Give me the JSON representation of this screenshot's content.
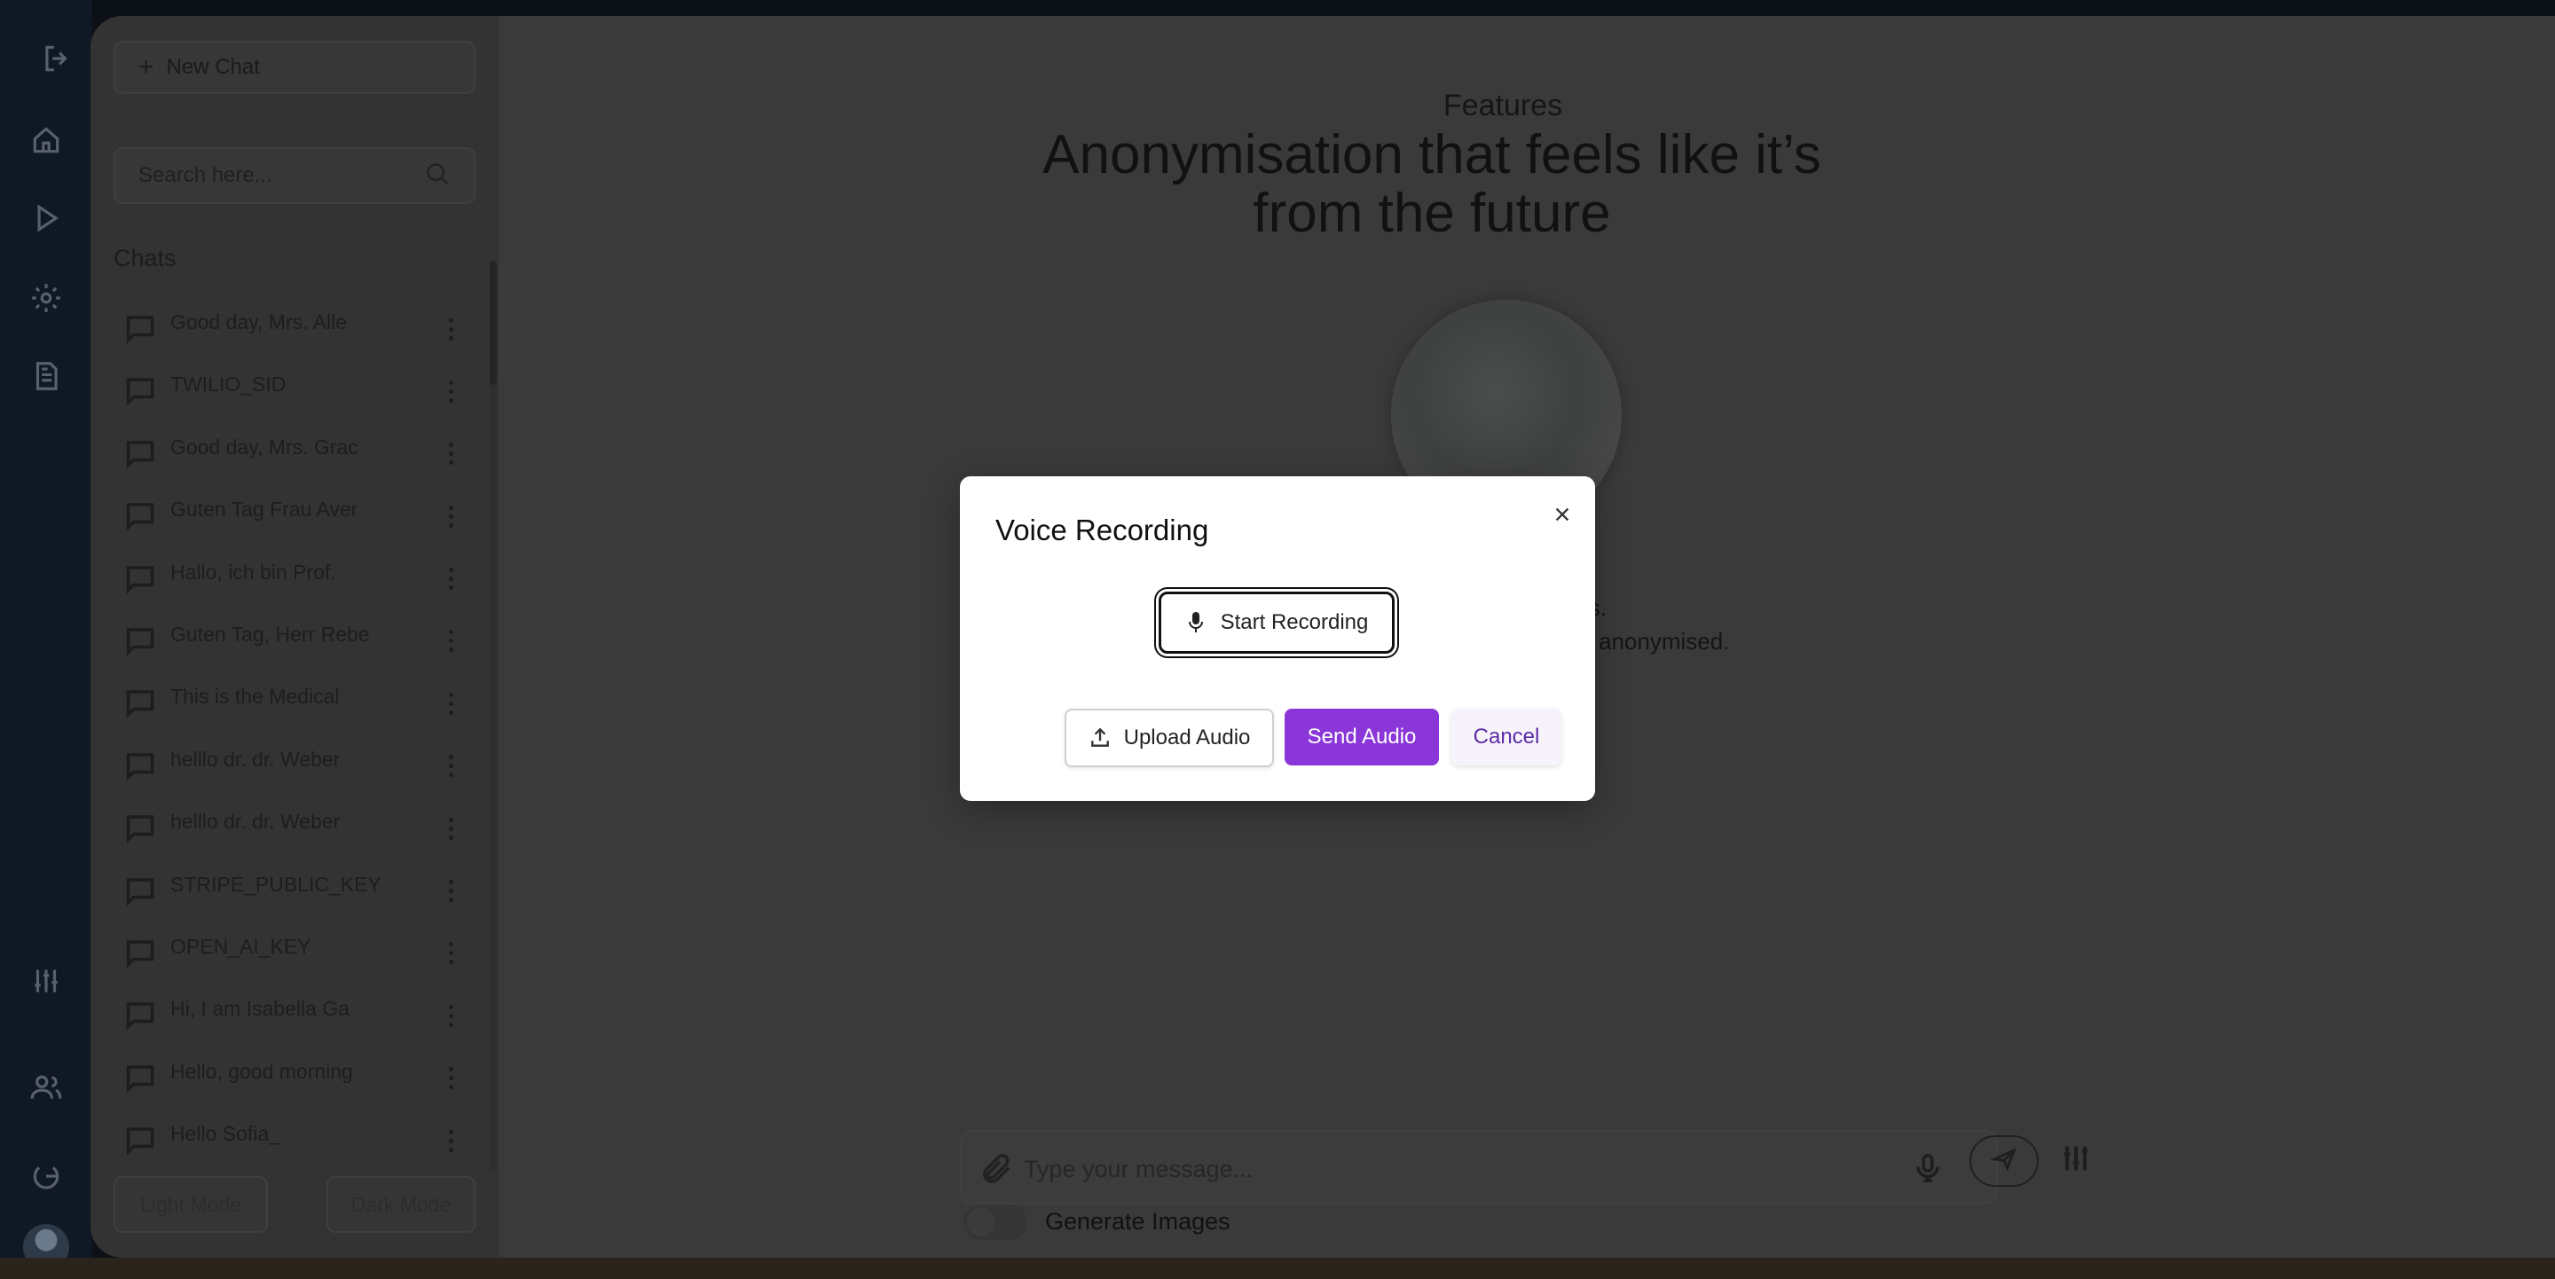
{
  "sidebar": {
    "new_chat_label": "New Chat",
    "search_placeholder": "Search here...",
    "chats_heading": "Chats",
    "chats": [
      {
        "label": "Good day, Mrs. Alle"
      },
      {
        "label": "TWILIO_SID"
      },
      {
        "label": "Good day, Mrs. Grac"
      },
      {
        "label": "Guten Tag Frau Aver"
      },
      {
        "label": "Hallo, ich bin Prof."
      },
      {
        "label": "Guten Tag, Herr Rebe"
      },
      {
        "label": "This is the Medical"
      },
      {
        "label": "helllo dr. dr. Weber"
      },
      {
        "label": "helllo dr. dr. Weber"
      },
      {
        "label": "STRIPE_PUBLIC_KEY"
      },
      {
        "label": "OPEN_AI_KEY"
      },
      {
        "label": "Hi, I am Isabella Ga"
      },
      {
        "label": "Hello, good morning"
      },
      {
        "label": "Hello Sofia_"
      }
    ],
    "light_mode_label": "Light Mode",
    "dark_mode_label": "Dark Mode"
  },
  "rail": {
    "icons": [
      "logout-icon",
      "home-icon",
      "play-icon",
      "settings-icon",
      "document-icon",
      "sliders-icon",
      "users-icon",
      "power-icon"
    ]
  },
  "main": {
    "eyebrow": "Features",
    "headline": "Anonymisation that feels like it’s from the future",
    "desc_line1_partial": "nds.",
    "desc_line2_partial": "anonymised.",
    "composer_placeholder": "Type your message...",
    "generate_images_label": "Generate Images"
  },
  "modal": {
    "title": "Voice Recording",
    "start_recording_label": "Start Recording",
    "upload_audio_label": "Upload Audio",
    "send_audio_label": "Send Audio",
    "cancel_label": "Cancel"
  },
  "colors": {
    "accent": "#8a36d8",
    "cancel_text": "#5a2ba6",
    "overlay_bg": "#3a3a3a"
  }
}
